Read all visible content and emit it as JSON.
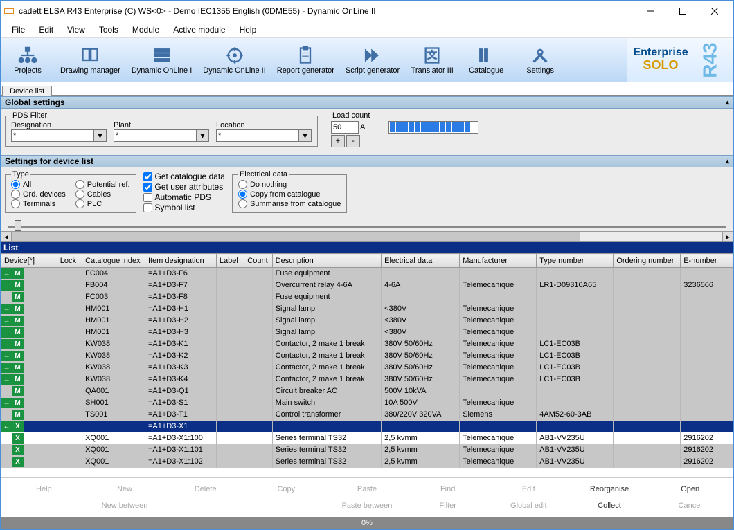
{
  "window": {
    "title": "cadett ELSA R43 Enterprise (C) WS<0> - Demo IEC1355 English (0DME55) - Dynamic OnLine II"
  },
  "menu": [
    "File",
    "Edit",
    "View",
    "Tools",
    "Module",
    "Active module",
    "Help"
  ],
  "toolbar": [
    {
      "label": "Projects"
    },
    {
      "label": "Drawing manager"
    },
    {
      "label": "Dynamic OnLine I"
    },
    {
      "label": "Dynamic OnLine II"
    },
    {
      "label": "Report generator"
    },
    {
      "label": "Script generator"
    },
    {
      "label": "Translator III"
    },
    {
      "label": "Catalogue"
    },
    {
      "label": "Settings"
    }
  ],
  "brand": {
    "line1": "Enterprise",
    "line2": "SOLO",
    "ver": "R43"
  },
  "tabs": {
    "device_list": "Device list"
  },
  "sections": {
    "global": "Global settings",
    "device": "Settings for device list",
    "list": "List"
  },
  "pds": {
    "legend": "PDS Filter",
    "designation": {
      "label": "Designation",
      "value": "*"
    },
    "plant": {
      "label": "Plant",
      "value": "*"
    },
    "location": {
      "label": "Location",
      "value": "*"
    }
  },
  "loadcount": {
    "legend": "Load count",
    "value": "50",
    "suffix": "A",
    "plus": "+",
    "minus": "-"
  },
  "type": {
    "legend": "Type",
    "opts": [
      "All",
      "Potential ref.",
      "Ord. devices",
      "Cables",
      "Terminals",
      "PLC"
    ]
  },
  "checks": {
    "catalogue": "Get catalogue data",
    "userattr": "Get user attributes",
    "autopds": "Automatic PDS",
    "symbol": "Symbol list"
  },
  "electrical": {
    "legend": "Electrical data",
    "opts": [
      "Do nothing",
      "Copy from catalogue",
      "Summarise from catalogue"
    ]
  },
  "columns": [
    "Device[*]",
    "Lock",
    "Catalogue index",
    "Item designation",
    "Label",
    "Count",
    "Description",
    "Electrical data",
    "Manufacturer",
    "Type number",
    "Ordering number",
    "E-number"
  ],
  "rows": [
    {
      "badges": [
        "→",
        "M"
      ],
      "ci": "FC004",
      "item": "=A1+D3-F6",
      "desc": "Fuse equipment"
    },
    {
      "badges": [
        "→",
        "M"
      ],
      "ci": "FB004",
      "item": "=A1+D3-F7",
      "desc": "Overcurrent relay 4-6A",
      "ed": "4-6A",
      "mfr": "Telemecanique",
      "tn": "LR1-D09310A65",
      "en": "3236566"
    },
    {
      "badges": [
        "",
        "M"
      ],
      "ci": "FC003",
      "item": "=A1+D3-F8",
      "desc": "Fuse equipment"
    },
    {
      "badges": [
        "→",
        "M"
      ],
      "ci": "HM001",
      "item": "=A1+D3-H1",
      "desc": "Signal lamp",
      "ed": "<380V",
      "mfr": "Telemecanique"
    },
    {
      "badges": [
        "→",
        "M"
      ],
      "ci": "HM001",
      "item": "=A1+D3-H2",
      "desc": "Signal lamp",
      "ed": "<380V",
      "mfr": "Telemecanique"
    },
    {
      "badges": [
        "→",
        "M"
      ],
      "ci": "HM001",
      "item": "=A1+D3-H3",
      "desc": "Signal lamp",
      "ed": "<380V",
      "mfr": "Telemecanique"
    },
    {
      "badges": [
        "→",
        "M"
      ],
      "ci": "KW038",
      "item": "=A1+D3-K1",
      "desc": "Contactor, 2 make 1 break",
      "ed": "380V 50/60Hz",
      "mfr": "Telemecanique",
      "tn": "LC1-EC03B"
    },
    {
      "badges": [
        "→",
        "M"
      ],
      "ci": "KW038",
      "item": "=A1+D3-K2",
      "desc": "Contactor, 2 make 1 break",
      "ed": "380V 50/60Hz",
      "mfr": "Telemecanique",
      "tn": "LC1-EC03B"
    },
    {
      "badges": [
        "→",
        "M"
      ],
      "ci": "KW038",
      "item": "=A1+D3-K3",
      "desc": "Contactor, 2 make 1 break",
      "ed": "380V 50/60Hz",
      "mfr": "Telemecanique",
      "tn": "LC1-EC03B"
    },
    {
      "badges": [
        "→",
        "M"
      ],
      "ci": "KW038",
      "item": "=A1+D3-K4",
      "desc": "Contactor, 2 make 1 break",
      "ed": "380V 50/60Hz",
      "mfr": "Telemecanique",
      "tn": "LC1-EC03B"
    },
    {
      "badges": [
        "",
        "M"
      ],
      "ci": "QA001",
      "item": "=A1+D3-Q1",
      "desc": "Circuit breaker AC",
      "ed": "500V 10kVA"
    },
    {
      "badges": [
        "→",
        "M"
      ],
      "ci": "SH001",
      "item": "=A1+D3-S1",
      "desc": "Main switch",
      "ed": "10A 500V",
      "mfr": "Telemecanique"
    },
    {
      "badges": [
        "",
        "M"
      ],
      "ci": "TS001",
      "item": "=A1+D3-T1",
      "desc": "Control transformer",
      "ed": "380/220V 320VA",
      "mfr": "Siemens",
      "tn": "4AM52-60-3AB"
    },
    {
      "badges": [
        "←",
        "X"
      ],
      "sel": true,
      "item": "=A1+D3-X1"
    },
    {
      "badges": [
        "",
        "X"
      ],
      "ci": "XQ001",
      "item": "=A1+D3-X1:100",
      "desc": "Series terminal TS32",
      "ed": "2,5 kvmm",
      "mfr": "Telemecanique",
      "tn": "AB1-VV235U",
      "en": "2916202",
      "white": true
    },
    {
      "badges": [
        "",
        "X"
      ],
      "ci": "XQ001",
      "item": "=A1+D3-X1:101",
      "desc": "Series terminal TS32",
      "ed": "2,5 kvmm",
      "mfr": "Telemecanique",
      "tn": "AB1-VV235U",
      "en": "2916202"
    },
    {
      "badges": [
        "",
        "X"
      ],
      "ci": "XQ001",
      "item": "=A1+D3-X1:102",
      "desc": "Series terminal TS32",
      "ed": "2,5 kvmm",
      "mfr": "Telemecanique",
      "tn": "AB1-VV235U",
      "en": "2916202"
    }
  ],
  "footer": {
    "row1": [
      "Help",
      "New",
      "Delete",
      "Copy",
      "Paste",
      "Find",
      "Edit",
      "Reorganise",
      "Open"
    ],
    "row2": [
      "",
      "New between",
      "",
      "",
      "Paste between",
      "Filter",
      "Global edit",
      "Collect",
      "Cancel"
    ]
  },
  "status": {
    "pct": "0%"
  }
}
